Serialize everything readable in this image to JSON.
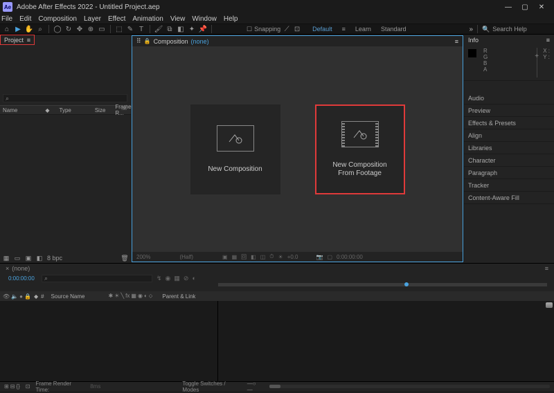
{
  "window": {
    "logo": "Ae",
    "title": "Adobe After Effects 2022 - Untitled Project.aep"
  },
  "menu": [
    "File",
    "Edit",
    "Composition",
    "Layer",
    "Effect",
    "Animation",
    "View",
    "Window",
    "Help"
  ],
  "toolbar": {
    "snapping": "Snapping",
    "workspaces": [
      "Default",
      "Learn",
      "Standard"
    ],
    "search_placeholder": "Search Help"
  },
  "project": {
    "tab": "Project",
    "search_icon": "⌕",
    "headers": [
      "Name",
      "Type",
      "Size",
      "Frame R..."
    ],
    "footer_bpc": "8 bpc"
  },
  "composition": {
    "tab": "Composition",
    "current": "(none)",
    "cards": {
      "new_comp": "New Composition",
      "from_footage_l1": "New Composition",
      "from_footage_l2": "From Footage"
    },
    "footer": {
      "zoom": "200%",
      "res": "(Half)",
      "time": "0:00:00:00",
      "exp": "+0.0"
    }
  },
  "info": {
    "tab": "Info",
    "channels": [
      "R",
      "G",
      "B",
      "A"
    ],
    "coords": [
      "X :",
      "Y :"
    ]
  },
  "side_panels": [
    "Audio",
    "Preview",
    "Effects & Presets",
    "Align",
    "Libraries",
    "Character",
    "Paragraph",
    "Tracker",
    "Content-Aware Fill"
  ],
  "timeline": {
    "tab": "(none)",
    "timecode": "0:00:00:00",
    "search_icon": "⌕",
    "col_source": "Source Name",
    "col_parent": "Parent & Link"
  },
  "status": {
    "frt_label": "Frame Render Time:",
    "frt_value": "8ms",
    "toggles": "Toggle Switches / Modes"
  }
}
